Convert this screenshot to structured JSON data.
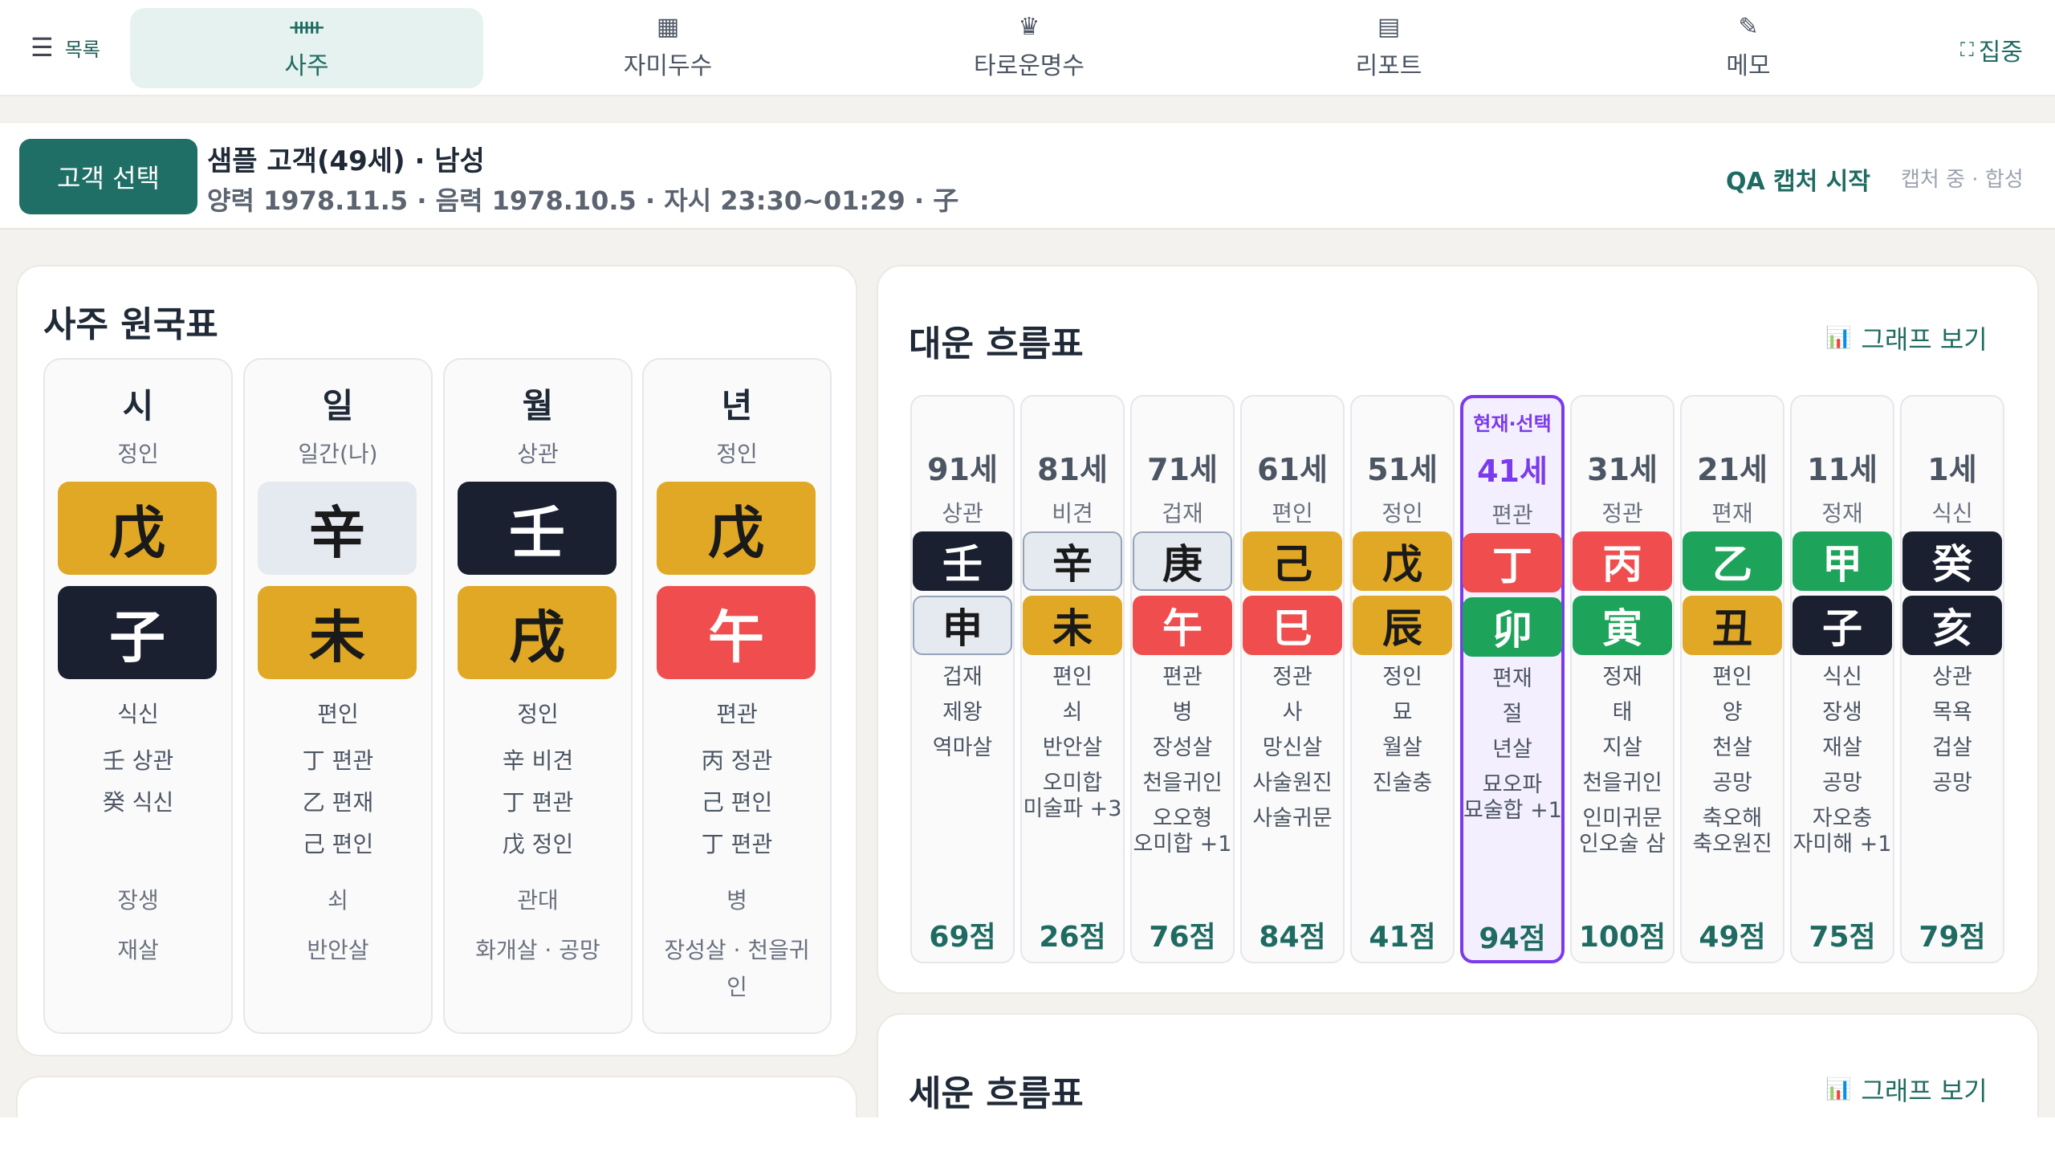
{
  "nav": {
    "menu_label": "목록",
    "tabs": [
      {
        "label": "사주",
        "icon": "pillars-icon",
        "glyph": "ᚔ"
      },
      {
        "label": "자미두수",
        "icon": "grid-icon",
        "glyph": "▦"
      },
      {
        "label": "타로운명수",
        "icon": "cards-icon",
        "glyph": "♛"
      },
      {
        "label": "리포트",
        "icon": "document-icon",
        "glyph": "▤"
      },
      {
        "label": "메모",
        "icon": "memo-icon",
        "glyph": "✎"
      }
    ],
    "active_tab": "사주",
    "focus_label": "집중"
  },
  "customer": {
    "select_label": "고객 선택",
    "name_line": "샘플 고객(49세) · 남성",
    "detail_line": "양력 1978.11.5 · 음력 1978.10.5 · 자시 23:30~01:29 · 子",
    "qa_label": "QA 캡처 시작",
    "capture_status": "캡처 중 · 합성"
  },
  "saju": {
    "title": "사주 원국표",
    "pillars": [
      {
        "head": "시",
        "god": "정인",
        "stem": "戊",
        "stem_el": "earth",
        "branch": "子",
        "branch_el": "water",
        "branch_god": "식신",
        "hidden": [
          "壬 상관",
          "癸 식신"
        ],
        "stage": "장생",
        "sal": "재살"
      },
      {
        "head": "일",
        "god": "일간(나)",
        "stem": "辛",
        "stem_el": "metal",
        "branch": "未",
        "branch_el": "earth",
        "branch_god": "편인",
        "hidden": [
          "丁 편관",
          "乙 편재",
          "己 편인"
        ],
        "stage": "쇠",
        "sal": "반안살"
      },
      {
        "head": "월",
        "god": "상관",
        "stem": "壬",
        "stem_el": "water",
        "branch": "戌",
        "branch_el": "earth",
        "branch_god": "정인",
        "hidden": [
          "辛 비견",
          "丁 편관",
          "戊 정인"
        ],
        "stage": "관대",
        "sal": "화개살 · 공망"
      },
      {
        "head": "년",
        "god": "정인",
        "stem": "戊",
        "stem_el": "earth",
        "branch": "午",
        "branch_el": "fire",
        "branch_god": "편관",
        "hidden": [
          "丙 정관",
          "己 편인",
          "丁 편관"
        ],
        "stage": "병",
        "sal": "장성살 · 천을귀",
        "sal2": "인"
      }
    ]
  },
  "daeun": {
    "title": "대운 흐름표",
    "graph_label": "그래프 보기",
    "selected_label": "현재·선택",
    "columns": [
      {
        "age": "91세",
        "god": "상관",
        "stem": "壬",
        "stem_el": "water",
        "branch": "申",
        "branch_el": "metal",
        "lines": [
          "겁재",
          "제왕",
          "역마살"
        ],
        "extra": [],
        "score": "69점"
      },
      {
        "age": "81세",
        "god": "비견",
        "stem": "辛",
        "stem_el": "metal",
        "branch": "未",
        "branch_el": "earth",
        "lines": [
          "편인",
          "쇠",
          "반안살"
        ],
        "extra": [
          "오미합",
          "미술파 +3"
        ],
        "score": "26점"
      },
      {
        "age": "71세",
        "god": "겁재",
        "stem": "庚",
        "stem_el": "metal",
        "branch": "午",
        "branch_el": "fire",
        "lines": [
          "편관",
          "병",
          "장성살",
          "천을귀인"
        ],
        "extra": [
          "오오형",
          "오미합 +1"
        ],
        "score": "76점"
      },
      {
        "age": "61세",
        "god": "편인",
        "stem": "己",
        "stem_el": "earth",
        "branch": "巳",
        "branch_el": "fire",
        "lines": [
          "정관",
          "사",
          "망신살",
          "사술원진"
        ],
        "extra": [
          "사술귀문"
        ],
        "score": "84점"
      },
      {
        "age": "51세",
        "god": "정인",
        "stem": "戊",
        "stem_el": "earth",
        "branch": "辰",
        "branch_el": "earth",
        "lines": [
          "정인",
          "묘",
          "월살",
          "진술충"
        ],
        "extra": [],
        "score": "41점"
      },
      {
        "age": "41세",
        "god": "편관",
        "stem": "丁",
        "stem_el": "fire",
        "branch": "卯",
        "branch_el": "wood",
        "lines": [
          "편재",
          "절",
          "년살"
        ],
        "extra": [
          "묘오파",
          "묘술합 +1"
        ],
        "score": "94점",
        "selected": true
      },
      {
        "age": "31세",
        "god": "정관",
        "stem": "丙",
        "stem_el": "fire",
        "branch": "寅",
        "branch_el": "wood",
        "lines": [
          "정재",
          "태",
          "지살",
          "천을귀인"
        ],
        "extra": [
          "인미귀문",
          "인오술 삼"
        ],
        "score": "100점"
      },
      {
        "age": "21세",
        "god": "편재",
        "stem": "乙",
        "stem_el": "wood",
        "branch": "丑",
        "branch_el": "earth",
        "lines": [
          "편인",
          "양",
          "천살",
          "공망"
        ],
        "extra": [
          "축오해",
          "축오원진"
        ],
        "score": "49점"
      },
      {
        "age": "11세",
        "god": "정재",
        "stem": "甲",
        "stem_el": "wood",
        "branch": "子",
        "branch_el": "water",
        "lines": [
          "식신",
          "장생",
          "재살",
          "공망"
        ],
        "extra": [
          "자오충",
          "자미해 +1"
        ],
        "score": "75점"
      },
      {
        "age": "1세",
        "god": "식신",
        "stem": "癸",
        "stem_el": "water",
        "branch": "亥",
        "branch_el": "water",
        "lines": [
          "상관",
          "목욕",
          "겁살",
          "공망"
        ],
        "extra": [],
        "score": "79점"
      }
    ]
  },
  "seun": {
    "title": "세운 흐름표",
    "graph_label": "그래프 보기"
  },
  "colors": {
    "accent": "#1f6f67",
    "selected": "#7c3aed",
    "earth": "#e0a824",
    "water": "#1a2030",
    "metal": "#e5e9f0",
    "fire": "#f04e4e",
    "wood": "#1ea35a"
  }
}
